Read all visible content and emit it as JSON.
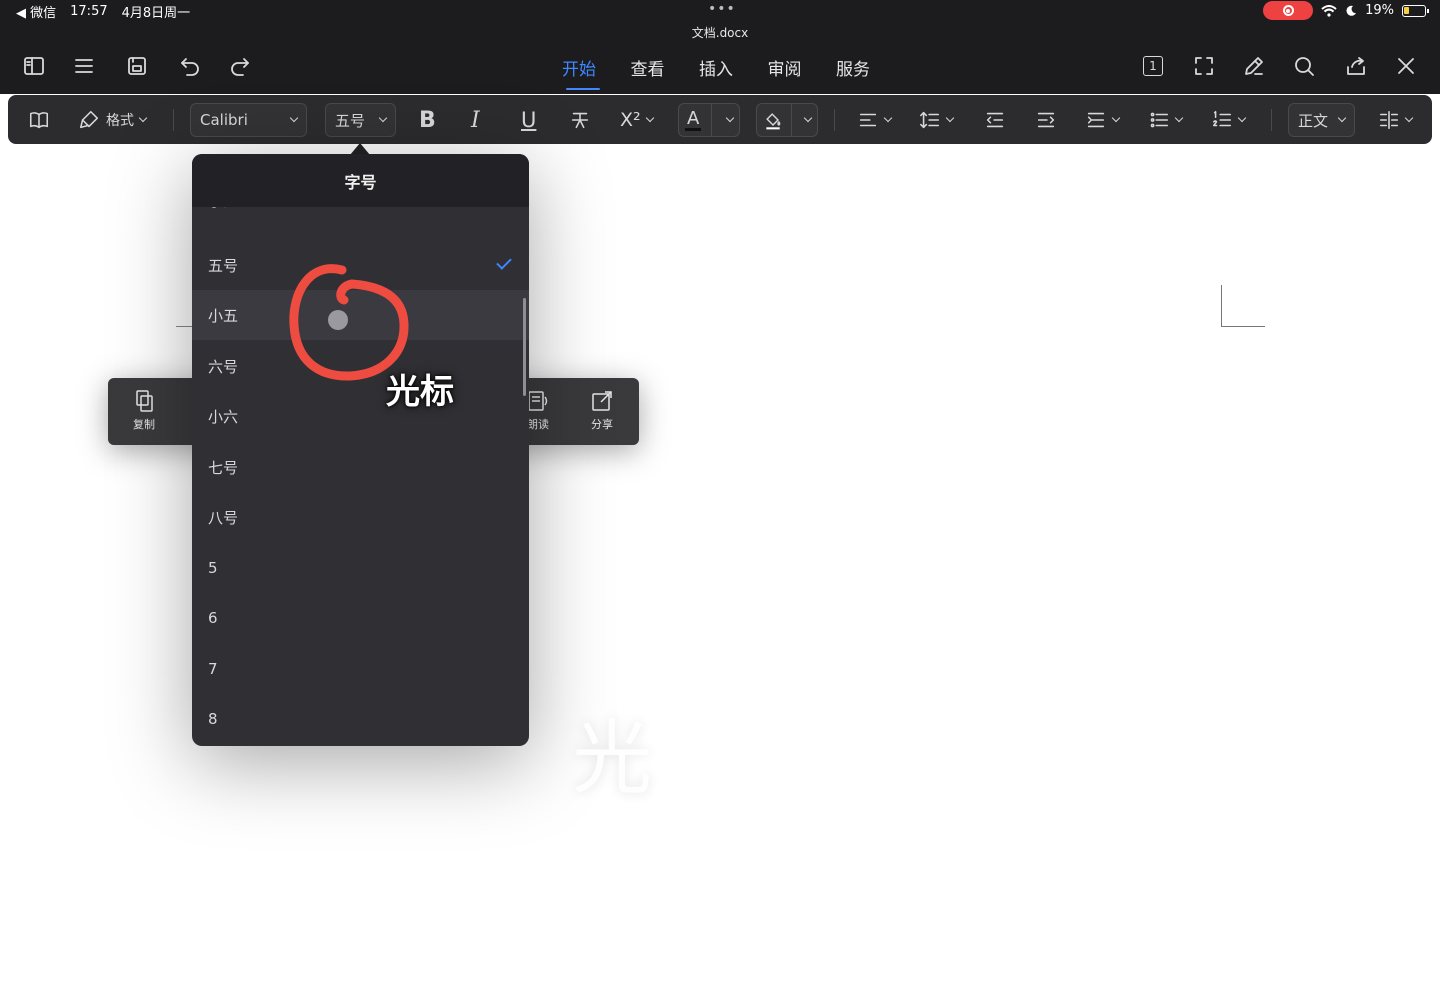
{
  "status_bar": {
    "back_app": "◀ 微信",
    "time": "17:57",
    "date": "4月8日周一",
    "dots": "•••",
    "battery": "19%"
  },
  "document": {
    "title": "文档.docx"
  },
  "nav": {
    "tabs": [
      {
        "label": "开始",
        "active": true
      },
      {
        "label": "查看",
        "active": false
      },
      {
        "label": "插入",
        "active": false
      },
      {
        "label": "审阅",
        "active": false
      },
      {
        "label": "服务",
        "active": false
      }
    ],
    "page_count_badge": "1"
  },
  "ribbon": {
    "format_label": "格式",
    "font_name": "Calibri",
    "font_size": "五号",
    "style_name": "正文",
    "superscript_label": "X²"
  },
  "context_menu": {
    "copy_label": "复制",
    "read_label": "朗读",
    "share_label": "分享"
  },
  "font_size_popover": {
    "title": "字号",
    "items": [
      "小四",
      "五号",
      "小五",
      "六号",
      "小六",
      "七号",
      "八号",
      "5",
      "6",
      "7",
      "8"
    ],
    "selected": "五号",
    "highlighted": "小五"
  },
  "annotation": {
    "label": "光标",
    "ghost_text": "光",
    "color": "#ee4b41"
  },
  "colors": {
    "accent": "#3f86ff",
    "toolbar_bg": "#1c1c1e",
    "ribbon_bg": "#2c2c2f",
    "popover_bg": "#2f2f34",
    "record_red": "#ee4141"
  }
}
